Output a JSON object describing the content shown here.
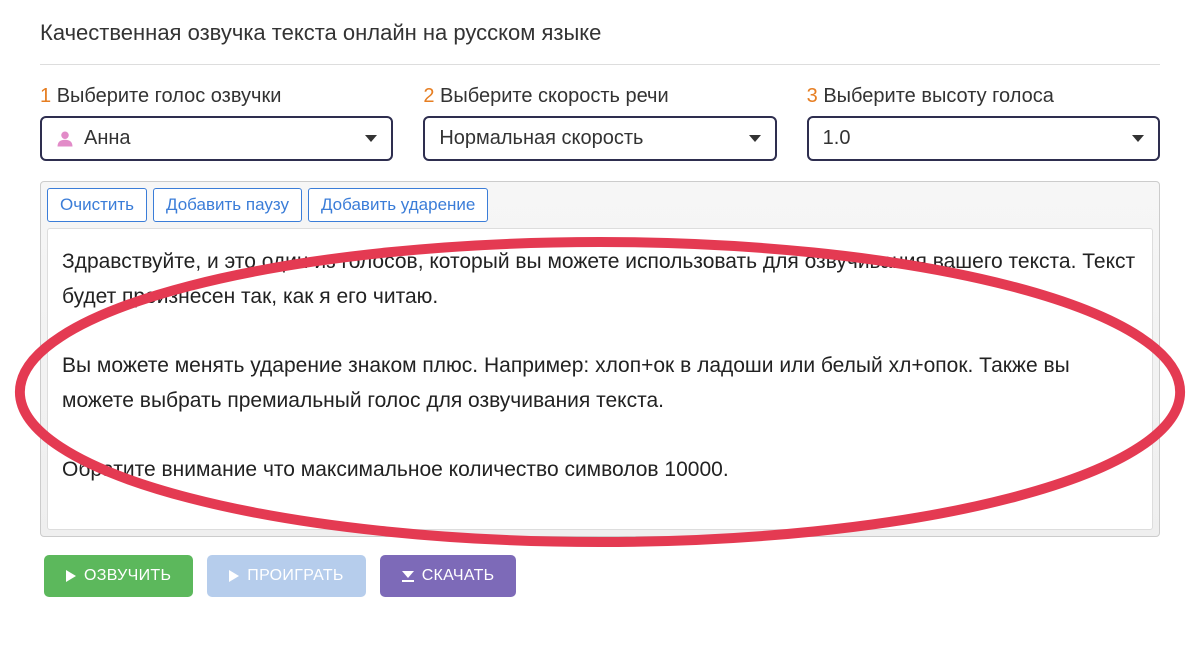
{
  "header": {
    "title": "Качественная озвучка текста онлайн на русском языке"
  },
  "steps": {
    "voice": {
      "num": "1",
      "label": "Выберите голос озвучки",
      "value": "Анна"
    },
    "speed": {
      "num": "2",
      "label": "Выберите скорость речи",
      "value": "Нормальная скорость"
    },
    "pitch": {
      "num": "3",
      "label": "Выберите высоту голоса",
      "value": "1.0"
    }
  },
  "toolbar": {
    "clear": "Очистить",
    "add_pause": "Добавить паузу",
    "add_stress": "Добавить ударение"
  },
  "editor": {
    "text": "Здравствуйте, и это один из голосов, который вы можете использовать для озвучивания вашего текста. Текст будет произнесен так, как я его читаю.\n\nВы можете менять ударение знаком плюс. Например: хлоп+ок в ладоши или белый хл+опок. Также вы можете выбрать премиальный голос для озвучивания текста.\n\nОбратите внимание что максимальное количество символов 10000."
  },
  "actions": {
    "speak": "ОЗВУЧИТЬ",
    "play": "ПРОИГРАТЬ",
    "download": "СКАЧАТЬ"
  },
  "colors": {
    "accent_num": "#e67e22",
    "dropdown_border": "#2e2e4f",
    "toolbar_btn": "#3b7dd8",
    "green": "#5cb85c",
    "blue_disabled": "#b6cdec",
    "purple": "#7d6ab8",
    "annotation_red": "#e43a52"
  }
}
